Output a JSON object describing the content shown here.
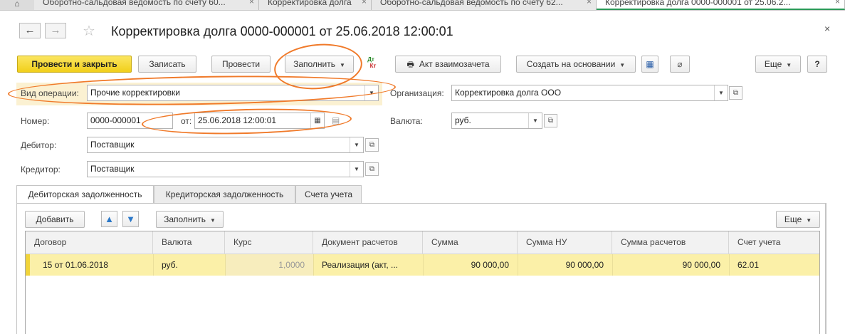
{
  "window_tabs": [
    {
      "label": "Оборотно-сальдовая ведомость по счету 60..."
    },
    {
      "label": "Корректировка долга"
    },
    {
      "label": "Оборотно-сальдовая ведомость по счету 62..."
    },
    {
      "label": "Корректировка долга 0000-000001 от 25.06.2..."
    }
  ],
  "header": {
    "title": "Корректировка долга 0000-000001 от 25.06.2018 12:00:01",
    "back": "←",
    "forward": "→"
  },
  "toolbar": {
    "post_close": "Провести и закрыть",
    "save": "Записать",
    "post": "Провести",
    "fill": "Заполнить",
    "dtkt_top": "Дт",
    "dtkt_bottom": "Кт",
    "offset_act": "Акт взаимозачета",
    "create_based": "Создать на основании",
    "more": "Еще",
    "help": "?"
  },
  "form": {
    "operation_label": "Вид операции:",
    "operation_value": "Прочие корректировки",
    "organization_label": "Организация:",
    "organization_value": "Корректировка долга ООО",
    "number_label": "Номер:",
    "number_value": "0000-000001",
    "date_label": "от:",
    "date_value": "25.06.2018 12:00:01",
    "currency_label": "Валюта:",
    "currency_value": "руб.",
    "debtor_label": "Дебитор:",
    "debtor_value": "Поставщик",
    "creditor_label": "Кредитор:",
    "creditor_value": "Поставщик"
  },
  "tabs": [
    {
      "label": "Дебиторская задолженность"
    },
    {
      "label": "Кредиторская задолженность"
    },
    {
      "label": "Счета учета"
    }
  ],
  "table_toolbar": {
    "add": "Добавить",
    "fill": "Заполнить",
    "more": "Еще"
  },
  "table": {
    "columns": [
      "Договор",
      "Валюта",
      "Курс",
      "Документ расчетов",
      "Сумма",
      "Сумма НУ",
      "Сумма расчетов",
      "Счет учета"
    ],
    "rows": [
      {
        "contract": "15 от 01.06.2018",
        "currency": "руб.",
        "rate": "1,0000",
        "document": "Реализация (акт, ...",
        "amount": "90 000,00",
        "amount_nu": "90 000,00",
        "amount_settlement": "90 000,00",
        "account": "62.01"
      }
    ]
  },
  "colors": {
    "primary_button": "#f1cf1a",
    "annotation": "#f07a2a",
    "selected_row": "#fbf0a8",
    "active_tab_underline": "#2a9a58"
  }
}
